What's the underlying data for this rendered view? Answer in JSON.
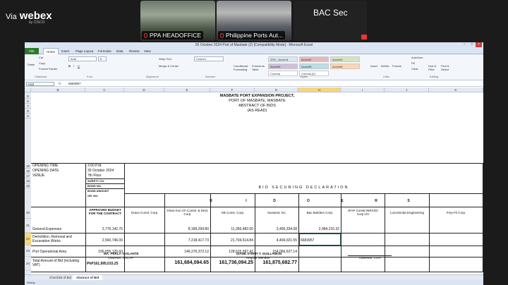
{
  "webex": {
    "via": "Via",
    "brand": "webex",
    "sub": "by CISCO",
    "tiles": [
      {
        "label": "PPA HEADOFFICE"
      },
      {
        "label": "Philippine Ports Aut..."
      },
      {
        "label": "BAC Sec"
      }
    ]
  },
  "excel": {
    "title": "25 October 2024 Port of Masbate (2) [Compatibility Mode] - Microsoft Excel",
    "ribbon_tabs": [
      "File",
      "Home",
      "Insert",
      "Page Layout",
      "Formulas",
      "Data",
      "Review",
      "View"
    ],
    "clipboard": {
      "paste": "Paste",
      "cut": "Cut",
      "copy": "Copy",
      "format_painter": "Format Painter",
      "group": "Clipboard"
    },
    "font": {
      "name": "Arial",
      "size": "8",
      "group": "Font"
    },
    "alignment": {
      "wrap": "Wrap Text",
      "merge": "Merge & Center",
      "group": "Alignment"
    },
    "number": {
      "format": "Custom",
      "group": "Number"
    },
    "styles": {
      "cond": "Conditional Formatting",
      "table": "Format as Table",
      "cells": [
        "20% - Accent1",
        "Accent2",
        "Accent3",
        "Accent4",
        "Accent5",
        "Accent6",
        "Comma",
        "Comma [0]"
      ],
      "group": "Styles"
    },
    "cells_group": {
      "insert": "Insert",
      "delete": "Delete",
      "format": "Format",
      "group": "Cells"
    },
    "editing": {
      "autosum": "AutoSum",
      "fill": "Fill",
      "clear": "Clear",
      "sort": "Sort & Filter",
      "find": "Find & Select",
      "group": "Editing"
    },
    "name_box": "H22",
    "fx": "fx",
    "formula": "6683957",
    "columns": [
      "B",
      "C",
      "D",
      "E",
      "F",
      "G",
      "H",
      "I",
      "J",
      "K"
    ],
    "rows": [
      "5",
      "6",
      "7",
      "8",
      "9",
      "15",
      "16",
      "17",
      "18",
      "19",
      "",
      "",
      "",
      "20",
      "21",
      "22",
      "23",
      "24",
      "25",
      "26",
      "",
      "30",
      "31",
      "32"
    ],
    "header": {
      "l1": "MASBATE PORT EXPANSION PROJECT,",
      "l2": "PORT OF MASBATE, MASBATE",
      "l3": "ABSTRACT OF BIDS",
      "l4": "(AS READ)"
    },
    "meta": {
      "opening_time_label": "OPENING TIME",
      "opening_time": "3:00 P.M.",
      "opening_date_label": "OPENING DATE",
      "opening_date": "30 October 2024",
      "venue_label": "VENUE",
      "venue": "7th Floor"
    },
    "bid_rows": [
      "SURETY CO.",
      "BOND NO.",
      "BOND AMOUNT",
      "OR. NO."
    ],
    "bid_securing": "BID SECURING DECLARATION",
    "letters": [
      "B",
      "I",
      "D",
      "O",
      "E",
      "R",
      "S"
    ],
    "budget_label": "APPROVED BUDGET FOR THE CONTRACT",
    "bidders": [
      "Grace Const. Corp.",
      "Khan-Kon Ch Constr. & Devt. Corp.",
      "SB Const. Corp.",
      "Sunwest, Inc.",
      "Bac Builders Corp.",
      "JFAP Constr./NRCDC Corp./JV",
      "Luzviminda Engineering",
      "Frey-Fil Corp."
    ],
    "items": [
      {
        "name": "General Expenses",
        "budget": "2,776,142.75",
        "values": [
          "",
          "8,189,294.80",
          "11,356,482.00",
          "3,405,334.08",
          "2,984,215.32",
          "",
          "",
          ""
        ]
      },
      {
        "name": "Demolition, Removal and Excavation Works",
        "budget": "2,560,746.00",
        "values": [
          "",
          "7,218,417.73",
          "21,704,514.84",
          "4,404,021.55",
          "6683957",
          "",
          "",
          ""
        ]
      },
      {
        "name": "Port Operational Area",
        "budget": "156,655,125.60",
        "values": [
          "",
          "146,276,372.12",
          "128,615,097.41",
          "154,066,627.14",
          "",
          "",
          "",
          ""
        ]
      }
    ],
    "total": {
      "label": "Total Amount of Bid (Including VAT)",
      "budget": "PhP161,995,015.25",
      "values": [
        "",
        "161,684,084.65",
        "161,736,094.25",
        "161,875,682.77",
        "",
        "",
        "",
        ""
      ]
    },
    "signatories": [
      {
        "name": "MA. PERLA TASLANTE",
        "role": "Observer, NACAP"
      },
      {
        "name": "DIANE STEFFI T. GUILLAMON",
        "role": "Regular Member"
      },
      {
        "name": "",
        "role": "Observer, COA"
      }
    ],
    "sheet_tabs": [
      "Checklist of Bid",
      "Abstract of Bid"
    ],
    "status": "Ready"
  }
}
